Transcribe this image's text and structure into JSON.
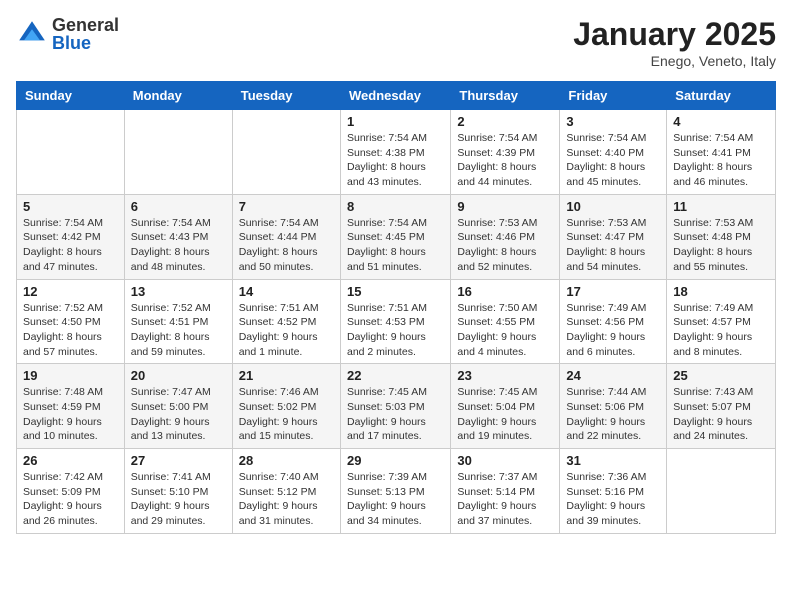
{
  "header": {
    "logo_general": "General",
    "logo_blue": "Blue",
    "month_title": "January 2025",
    "subtitle": "Enego, Veneto, Italy"
  },
  "days_of_week": [
    "Sunday",
    "Monday",
    "Tuesday",
    "Wednesday",
    "Thursday",
    "Friday",
    "Saturday"
  ],
  "weeks": [
    [
      {
        "day": "",
        "info": ""
      },
      {
        "day": "",
        "info": ""
      },
      {
        "day": "",
        "info": ""
      },
      {
        "day": "1",
        "info": "Sunrise: 7:54 AM\nSunset: 4:38 PM\nDaylight: 8 hours\nand 43 minutes."
      },
      {
        "day": "2",
        "info": "Sunrise: 7:54 AM\nSunset: 4:39 PM\nDaylight: 8 hours\nand 44 minutes."
      },
      {
        "day": "3",
        "info": "Sunrise: 7:54 AM\nSunset: 4:40 PM\nDaylight: 8 hours\nand 45 minutes."
      },
      {
        "day": "4",
        "info": "Sunrise: 7:54 AM\nSunset: 4:41 PM\nDaylight: 8 hours\nand 46 minutes."
      }
    ],
    [
      {
        "day": "5",
        "info": "Sunrise: 7:54 AM\nSunset: 4:42 PM\nDaylight: 8 hours\nand 47 minutes."
      },
      {
        "day": "6",
        "info": "Sunrise: 7:54 AM\nSunset: 4:43 PM\nDaylight: 8 hours\nand 48 minutes."
      },
      {
        "day": "7",
        "info": "Sunrise: 7:54 AM\nSunset: 4:44 PM\nDaylight: 8 hours\nand 50 minutes."
      },
      {
        "day": "8",
        "info": "Sunrise: 7:54 AM\nSunset: 4:45 PM\nDaylight: 8 hours\nand 51 minutes."
      },
      {
        "day": "9",
        "info": "Sunrise: 7:53 AM\nSunset: 4:46 PM\nDaylight: 8 hours\nand 52 minutes."
      },
      {
        "day": "10",
        "info": "Sunrise: 7:53 AM\nSunset: 4:47 PM\nDaylight: 8 hours\nand 54 minutes."
      },
      {
        "day": "11",
        "info": "Sunrise: 7:53 AM\nSunset: 4:48 PM\nDaylight: 8 hours\nand 55 minutes."
      }
    ],
    [
      {
        "day": "12",
        "info": "Sunrise: 7:52 AM\nSunset: 4:50 PM\nDaylight: 8 hours\nand 57 minutes."
      },
      {
        "day": "13",
        "info": "Sunrise: 7:52 AM\nSunset: 4:51 PM\nDaylight: 8 hours\nand 59 minutes."
      },
      {
        "day": "14",
        "info": "Sunrise: 7:51 AM\nSunset: 4:52 PM\nDaylight: 9 hours\nand 1 minute."
      },
      {
        "day": "15",
        "info": "Sunrise: 7:51 AM\nSunset: 4:53 PM\nDaylight: 9 hours\nand 2 minutes."
      },
      {
        "day": "16",
        "info": "Sunrise: 7:50 AM\nSunset: 4:55 PM\nDaylight: 9 hours\nand 4 minutes."
      },
      {
        "day": "17",
        "info": "Sunrise: 7:49 AM\nSunset: 4:56 PM\nDaylight: 9 hours\nand 6 minutes."
      },
      {
        "day": "18",
        "info": "Sunrise: 7:49 AM\nSunset: 4:57 PM\nDaylight: 9 hours\nand 8 minutes."
      }
    ],
    [
      {
        "day": "19",
        "info": "Sunrise: 7:48 AM\nSunset: 4:59 PM\nDaylight: 9 hours\nand 10 minutes."
      },
      {
        "day": "20",
        "info": "Sunrise: 7:47 AM\nSunset: 5:00 PM\nDaylight: 9 hours\nand 13 minutes."
      },
      {
        "day": "21",
        "info": "Sunrise: 7:46 AM\nSunset: 5:02 PM\nDaylight: 9 hours\nand 15 minutes."
      },
      {
        "day": "22",
        "info": "Sunrise: 7:45 AM\nSunset: 5:03 PM\nDaylight: 9 hours\nand 17 minutes."
      },
      {
        "day": "23",
        "info": "Sunrise: 7:45 AM\nSunset: 5:04 PM\nDaylight: 9 hours\nand 19 minutes."
      },
      {
        "day": "24",
        "info": "Sunrise: 7:44 AM\nSunset: 5:06 PM\nDaylight: 9 hours\nand 22 minutes."
      },
      {
        "day": "25",
        "info": "Sunrise: 7:43 AM\nSunset: 5:07 PM\nDaylight: 9 hours\nand 24 minutes."
      }
    ],
    [
      {
        "day": "26",
        "info": "Sunrise: 7:42 AM\nSunset: 5:09 PM\nDaylight: 9 hours\nand 26 minutes."
      },
      {
        "day": "27",
        "info": "Sunrise: 7:41 AM\nSunset: 5:10 PM\nDaylight: 9 hours\nand 29 minutes."
      },
      {
        "day": "28",
        "info": "Sunrise: 7:40 AM\nSunset: 5:12 PM\nDaylight: 9 hours\nand 31 minutes."
      },
      {
        "day": "29",
        "info": "Sunrise: 7:39 AM\nSunset: 5:13 PM\nDaylight: 9 hours\nand 34 minutes."
      },
      {
        "day": "30",
        "info": "Sunrise: 7:37 AM\nSunset: 5:14 PM\nDaylight: 9 hours\nand 37 minutes."
      },
      {
        "day": "31",
        "info": "Sunrise: 7:36 AM\nSunset: 5:16 PM\nDaylight: 9 hours\nand 39 minutes."
      },
      {
        "day": "",
        "info": ""
      }
    ]
  ]
}
